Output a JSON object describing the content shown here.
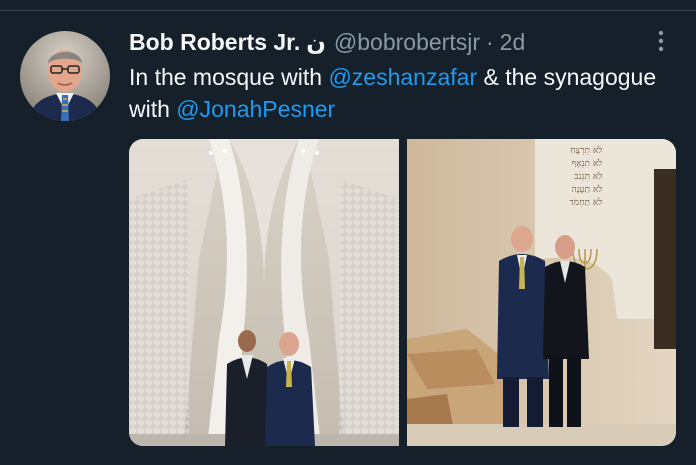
{
  "tweet": {
    "author_name": "Bob Roberts Jr.",
    "name_symbol": "ن",
    "handle": "@bobrobertsjr",
    "separator": "·",
    "time": "2d",
    "text_part1": "In the mosque with ",
    "mention1": "@zeshanzafar",
    "text_part2": " & the synagogue with ",
    "mention2": "@JonahPesner"
  },
  "synagogue_wall_inscription": [
    "לֹא תִרְצָח",
    "לֹא תִנְאָף",
    "לֹא תִגְנֹב",
    "לֹא תַעֲנֶה",
    "לֹא תַחְמֹד"
  ],
  "icons": {
    "more": "more-vertical-icon"
  },
  "colors": {
    "background": "#15202b",
    "text_primary": "#f7f9f9",
    "text_secondary": "#8b98a5",
    "link": "#1d9bf0"
  }
}
